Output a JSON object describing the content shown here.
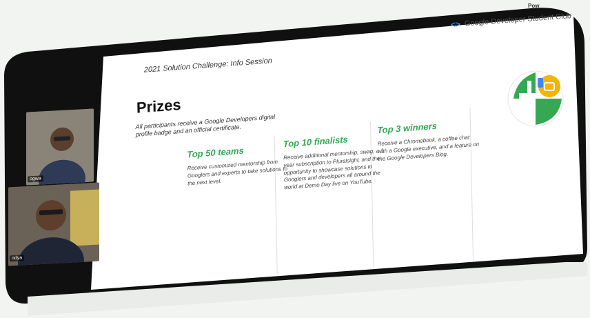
{
  "overlay_badge": "Pow",
  "brand_text": "Google Developer Student Club",
  "slide": {
    "session_title": "2021 Solution Challenge: Info Session",
    "heading": "Prizes",
    "intro": "All participants receive a Google Developers digital profile badge and an official certificate.",
    "columns": [
      {
        "title": "Top 50 teams",
        "body": "Receive customized mentorship from Googlers and experts to take solutions to the next level."
      },
      {
        "title": "Top 10 finalists",
        "body": "Receive additional mentorship, swag, a 1 year subscription to Pluralsight, and the opportunity to showcase solutions to Googlers and developers all around the world at Demo Day live on YouTube."
      },
      {
        "title": "Top 3 winners",
        "body": "Receive a Chromebook, a coffee chat with a Google executive, and a feature on the Google Developers Blog."
      }
    ]
  },
  "participants": [
    {
      "name_label": "ogwa"
    },
    {
      "name_label": "ndya"
    }
  ],
  "colors": {
    "accent_green": "#34a853",
    "google_blue": "#4285f4",
    "logo_orange": "#f4b400"
  },
  "icons": [
    "google-developers-chevron-icon",
    "solution-challenge-logo-icon"
  ]
}
